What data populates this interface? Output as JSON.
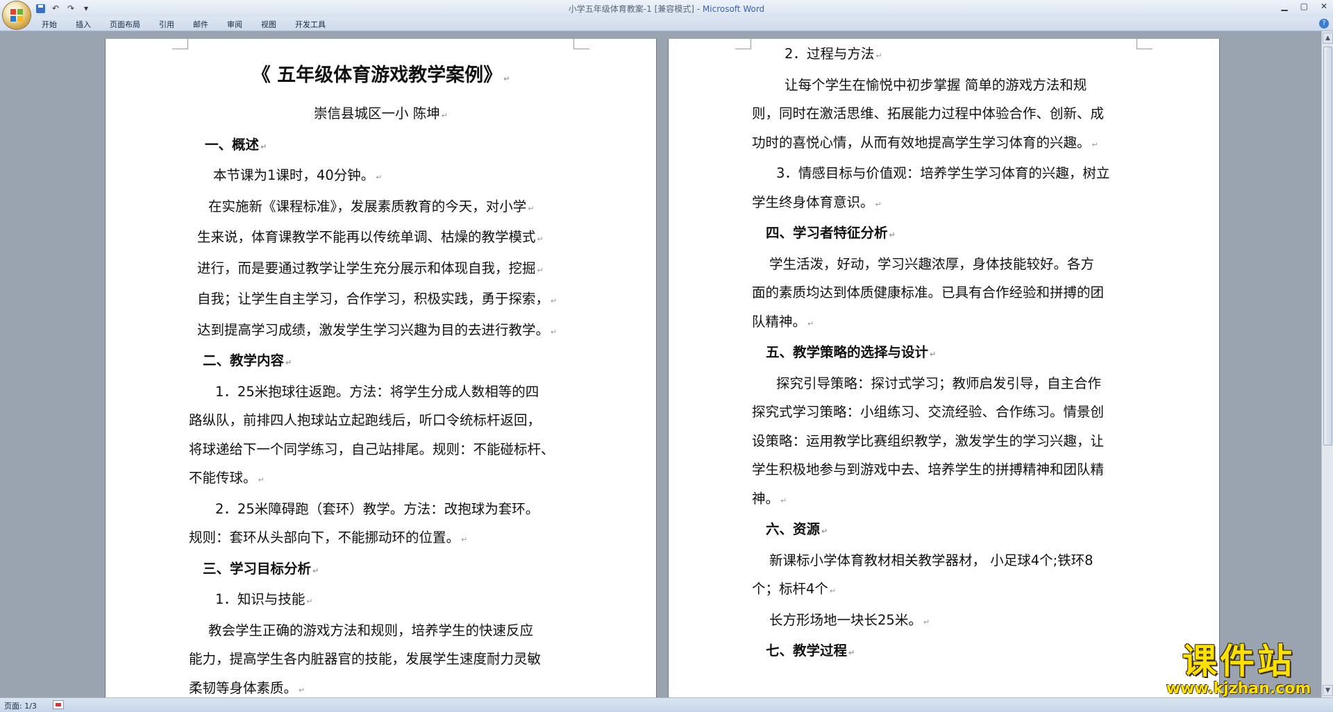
{
  "window": {
    "title_doc": "小学五年级体育教案-1 [兼容模式] - ",
    "title_app": "Microsoft Word"
  },
  "colors": {
    "accent": "#3b63a8",
    "page_bg": "#ffffff",
    "workspace": "#9aa3b0",
    "watermark": "#ffe100"
  },
  "ribbon": {
    "tabs": [
      "开始",
      "插入",
      "页面布局",
      "引用",
      "邮件",
      "审阅",
      "视图",
      "开发工具"
    ]
  },
  "page1": {
    "title": "《 五年级体育游戏教学案例》",
    "lines": [
      {
        "text": "崇信县城区一小        陈坤",
        "indent": 0,
        "center": true,
        "bold": false
      },
      {
        "text": "一、概述",
        "indent": 143,
        "bold": true
      },
      {
        "text": "本节课为1课时，40分钟。",
        "indent": 155,
        "bold": false
      },
      {
        "text": "在实施新《课程标准》，发展素质教育的今天，对小学",
        "indent": 148,
        "bold": false
      },
      {
        "text": "生来说，体育课教学不能再以传统单调、枯燥的教学模式",
        "indent": 132,
        "bold": false
      },
      {
        "text": "进行，而是要通过教学让学生充分展示和体现自我，挖掘",
        "indent": 132,
        "bold": false
      },
      {
        "text": "自我；让学生自主学习，合作学习，积极实践，勇于探索，",
        "indent": 132,
        "bold": false
      },
      {
        "text": "达到提高学习成绩，激发学生学习兴趣为目的去进行教学。",
        "indent": 132,
        "bold": false
      },
      {
        "text": "二、教学内容",
        "indent": 140,
        "bold": true
      },
      {
        "text": "1．25米抱球往返跑。方法：将学生分成人数相等的四",
        "indent": 158,
        "bold": false
      },
      {
        "text": "路纵队，前排四人抱球站立起跑线后，听口令统标杆返回，",
        "indent": 120,
        "bold": false
      },
      {
        "text": "将球递给下一个同学练习，自己站排尾。规则：不能碰标杆、",
        "indent": 120,
        "bold": false
      },
      {
        "text": "不能传球。",
        "indent": 120,
        "bold": false
      },
      {
        "text": "2．25米障碍跑（套环）教学。方法：改抱球为套环。",
        "indent": 158,
        "bold": false
      },
      {
        "text": "规则：套环从头部向下，不能挪动环的位置。",
        "indent": 120,
        "bold": false
      },
      {
        "text": "三、学习目标分析",
        "indent": 140,
        "bold": true
      },
      {
        "text": "1．知识与技能",
        "indent": 158,
        "bold": false
      },
      {
        "text": "教会学生正确的游戏方法和规则，培养学生的快速反应",
        "indent": 148,
        "bold": false
      },
      {
        "text": "能力，提高学生各内脏器官的技能，发展学生速度耐力灵敏",
        "indent": 120,
        "bold": false
      },
      {
        "text": "柔韧等身体素质。",
        "indent": 120,
        "bold": false
      }
    ]
  },
  "page2": {
    "lines": [
      {
        "text": "2．过程与方法",
        "indent": 167,
        "bold": false
      },
      {
        "text": "让每个学生在愉悦中初步掌握  简单的游戏方法和规",
        "indent": 167,
        "bold": false
      },
      {
        "text": "则，同时在激活思维、拓展能力过程中体验合作、创新、成",
        "indent": 120,
        "bold": false
      },
      {
        "text": "功时的喜悦心情，从而有效地提高学生学习体育的兴趣。",
        "indent": 120,
        "bold": false
      },
      {
        "text": "3．情感目标与价值观：培养学生学习体育的兴趣，树立",
        "indent": 155,
        "bold": false
      },
      {
        "text": "学生终身体育意识。",
        "indent": 120,
        "bold": false
      },
      {
        "text": "四、学习者特征分析",
        "indent": 140,
        "bold": true
      },
      {
        "text": "学生活泼，好动，学习兴趣浓厚，身体技能较好。各方",
        "indent": 145,
        "bold": false
      },
      {
        "text": "面的素质均达到体质健康标准。已具有合作经验和拼搏的团",
        "indent": 120,
        "bold": false
      },
      {
        "text": "队精神。",
        "indent": 120,
        "bold": false
      },
      {
        "text": "五、教学策略的选择与设计",
        "indent": 140,
        "bold": true
      },
      {
        "text": "探究引导策略：探讨式学习；教师启发引导，自主合作",
        "indent": 155,
        "bold": false
      },
      {
        "text": "探究式学习策略：小组练习、交流经验、合作练习。情景创",
        "indent": 120,
        "bold": false
      },
      {
        "text": "设策略：运用教学比赛组织教学，激发学生的学习兴趣，让",
        "indent": 120,
        "bold": false
      },
      {
        "text": "学生积极地参与到游戏中去、培养学生的拼搏精神和团队精",
        "indent": 120,
        "bold": false
      },
      {
        "text": "神。",
        "indent": 120,
        "bold": false
      },
      {
        "text": "六、资源",
        "indent": 140,
        "bold": true
      },
      {
        "text": "新课标小学体育教材相关教学器材，  小足球4个;铁环8",
        "indent": 145,
        "bold": false
      },
      {
        "text": "个；标杆4个",
        "indent": 120,
        "bold": false
      },
      {
        "text": "长方形场地一块长25米。",
        "indent": 145,
        "bold": false
      },
      {
        "text": "七、教学过程",
        "indent": 140,
        "bold": true
      }
    ]
  },
  "status": {
    "page": "页面: 1/3"
  },
  "watermark": {
    "main": "课件站",
    "url": "www.kjzhan.com"
  }
}
